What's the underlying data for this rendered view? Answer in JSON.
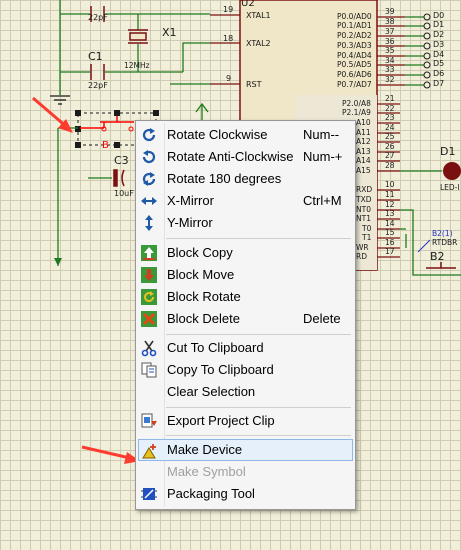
{
  "schematic": {
    "chip_ref": "U2",
    "left_pins": [
      {
        "num": "19",
        "name": "XTAL1"
      },
      {
        "num": "18",
        "name": "XTAL2"
      },
      {
        "num": "9",
        "name": "RST"
      }
    ],
    "port0_pins": [
      {
        "name": "P0.0/AD0",
        "num": "39",
        "net": "D0"
      },
      {
        "name": "P0.1/AD1",
        "num": "38",
        "net": "D1"
      },
      {
        "name": "P0.2/AD2",
        "num": "37",
        "net": "D2"
      },
      {
        "name": "P0.3/AD3",
        "num": "36",
        "net": "D3"
      },
      {
        "name": "P0.4/AD4",
        "num": "35",
        "net": "D4"
      },
      {
        "name": "P0.5/AD5",
        "num": "34",
        "net": "D5"
      },
      {
        "name": "P0.6/AD6",
        "num": "33",
        "net": "D6"
      },
      {
        "name": "P0.7/AD7",
        "num": "32",
        "net": "D7"
      }
    ],
    "port2_pins": [
      {
        "name": "P2.0/A8",
        "num": "21"
      },
      {
        "name": "P2.1/A9",
        "num": "22"
      },
      {
        "name": "A10",
        "num": "23"
      },
      {
        "name": "A11",
        "num": "24"
      },
      {
        "name": "A12",
        "num": "25"
      },
      {
        "name": "A13",
        "num": "26"
      },
      {
        "name": "A14",
        "num": "27"
      },
      {
        "name": "A15",
        "num": "28"
      }
    ],
    "port3_pins": [
      {
        "name": "RXD",
        "num": "10"
      },
      {
        "name": "TXD",
        "num": "11"
      },
      {
        "name": "NT0",
        "num": "12"
      },
      {
        "name": "NT1",
        "num": "13"
      },
      {
        "name": "T0",
        "num": "14"
      },
      {
        "name": "T1",
        "num": "15"
      },
      {
        "name": "WR",
        "num": "16"
      },
      {
        "name": "RD",
        "num": "17"
      }
    ],
    "cap_top_value": "22pF",
    "cap_c1_ref": "C1",
    "cap_c1_value": "22pF",
    "crystal_ref": "X1",
    "crystal_value": "12MHz",
    "cap_c3_ref": "C3",
    "cap_c3_value": "10uF",
    "button_ref": "B",
    "led_ref": "D1",
    "led_value": "LED-I",
    "b2_probe": "B2(1)",
    "b2_value": "RTDBR",
    "b2_ref": "B2"
  },
  "context_menu": {
    "items": [
      {
        "label": "Rotate Clockwise",
        "shortcut": "Num--",
        "icon": "rotate-clockwise-icon"
      },
      {
        "label": "Rotate Anti-Clockwise",
        "shortcut": "Num-+",
        "icon": "rotate-anticlockwise-icon"
      },
      {
        "label": "Rotate 180 degrees",
        "shortcut": "",
        "icon": "rotate-180-icon"
      },
      {
        "label": "X-Mirror",
        "shortcut": "Ctrl+M",
        "icon": "x-mirror-icon"
      },
      {
        "label": "Y-Mirror",
        "shortcut": "",
        "icon": "y-mirror-icon"
      },
      {
        "label": "Block Copy",
        "shortcut": "",
        "icon": "block-copy-icon"
      },
      {
        "label": "Block Move",
        "shortcut": "",
        "icon": "block-move-icon"
      },
      {
        "label": "Block Rotate",
        "shortcut": "",
        "icon": "block-rotate-icon"
      },
      {
        "label": "Block Delete",
        "shortcut": "Delete",
        "icon": "block-delete-icon"
      },
      {
        "label": "Cut To Clipboard",
        "shortcut": "",
        "icon": "scissors-icon"
      },
      {
        "label": "Copy To Clipboard",
        "shortcut": "",
        "icon": "copy-icon"
      },
      {
        "label": "Clear Selection",
        "shortcut": "",
        "icon": ""
      },
      {
        "label": "Export Project Clip",
        "shortcut": "",
        "icon": "export-clip-icon"
      },
      {
        "label": "Make Device",
        "shortcut": "",
        "icon": "make-device-icon",
        "highlighted": true
      },
      {
        "label": "Make Symbol",
        "shortcut": "",
        "icon": "",
        "disabled": true
      },
      {
        "label": "Packaging Tool",
        "shortcut": "",
        "icon": "packaging-tool-icon"
      }
    ]
  },
  "colors": {
    "wire": "#1f7a1f",
    "component": "#7a1010",
    "selection": "#ff0000",
    "annotation_arrow": "#ff3b30",
    "chip_fill": "#f0e6c8",
    "highlight": "#e5f0fb"
  }
}
